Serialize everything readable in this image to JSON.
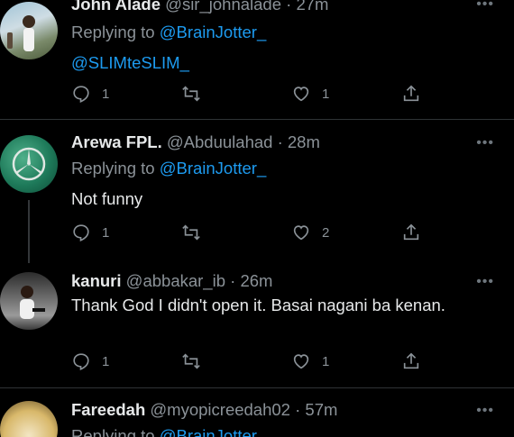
{
  "tweets": [
    {
      "name": "John Alade",
      "handle": "@sir_johnalade",
      "time": "27m",
      "replying_prefix": "Replying to",
      "replying_to": "@BrainJotter_",
      "body": "@SLIMteSLIM_",
      "replies": "1",
      "retweets": "",
      "likes": "1"
    },
    {
      "name": "Arewa FPL.",
      "handle": "@Abduulahad",
      "time": "28m",
      "replying_prefix": "Replying to",
      "replying_to": "@BrainJotter_",
      "body": "Not funny",
      "replies": "1",
      "retweets": "",
      "likes": "2"
    },
    {
      "name": "kanuri",
      "handle": "@abbakar_ib",
      "time": "26m",
      "body": "Thank God I didn't open it. Basai nagani ba kenan.",
      "replies": "1",
      "retweets": "",
      "likes": "1"
    },
    {
      "name": "Fareedah",
      "handle": "@myopicreedah02",
      "time": "57m",
      "replying_prefix": "Replying to",
      "replying_to": "@BrainJotter_"
    }
  ],
  "separator": "·",
  "icons": {
    "reply": "reply-icon",
    "retweet": "retweet-icon",
    "like": "heart-icon",
    "share": "share-icon",
    "more": "more-icon"
  },
  "colors": {
    "link": "#1d9bf0",
    "muted": "#8b9298",
    "text": "#e7e9ea",
    "background": "#000000"
  }
}
